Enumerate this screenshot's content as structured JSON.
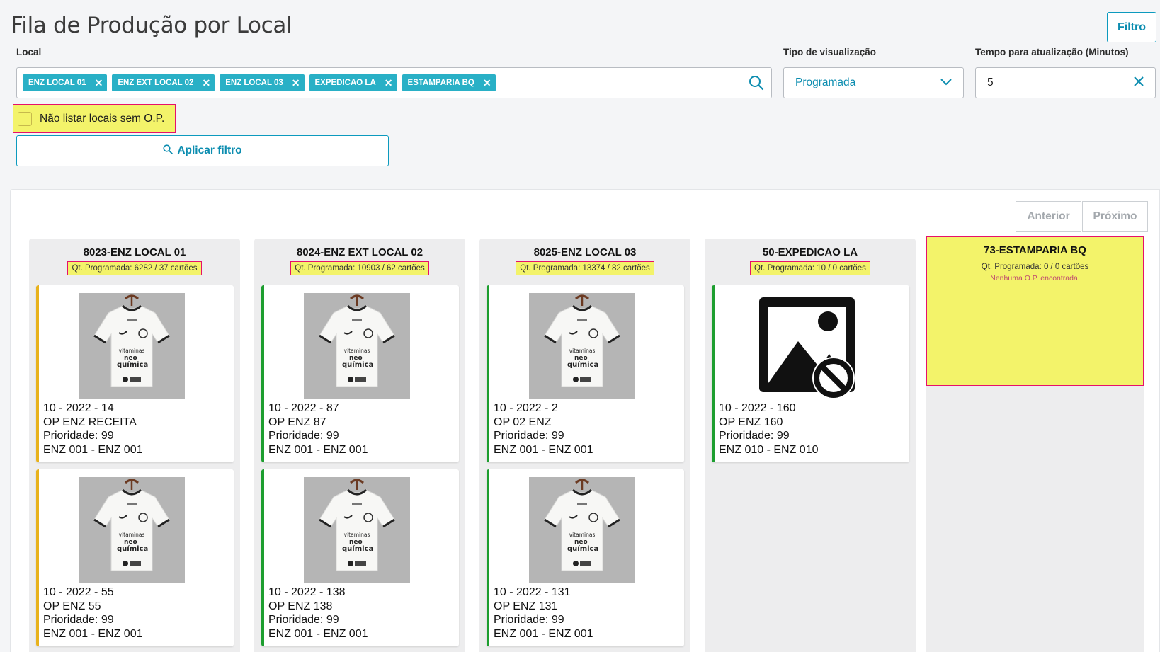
{
  "header": {
    "title": "Fila de Produção por Local",
    "filter_button": "Filtro"
  },
  "filters": {
    "local_label": "Local",
    "locals": [
      "ENZ LOCAL 01",
      "ENZ EXT LOCAL 02",
      "ENZ LOCAL 03",
      "EXPEDICAO LA",
      "ESTAMPARIA BQ"
    ],
    "view_type_label": "Tipo de visualização",
    "view_type_value": "Programada",
    "refresh_label": "Tempo para atualização (Minutos)",
    "refresh_value": "5",
    "checkbox_label": "Não listar locais sem O.P.",
    "apply_button": "Aplicar filtro"
  },
  "pager": {
    "prev": "Anterior",
    "next": "Próximo"
  },
  "columns": [
    {
      "title": "8023-ENZ LOCAL 01",
      "qt": "Qt. Programada: 6282 / 37 cartões",
      "cards": [
        {
          "line1": "10 - 2022 - 14",
          "line2": "OP ENZ RECEITA",
          "line3": "Prioridade: 99",
          "line4": "ENZ 001 - ENZ 001"
        },
        {
          "line1": "10 - 2022 - 55",
          "line2": "OP ENZ 55",
          "line3": "Prioridade: 99",
          "line4": "ENZ 001 - ENZ 001"
        }
      ]
    },
    {
      "title": "8024-ENZ EXT LOCAL 02",
      "qt": "Qt. Programada: 10903 / 62 cartões",
      "cards": [
        {
          "line1": "10 - 2022 - 87",
          "line2": "OP ENZ 87",
          "line3": "Prioridade: 99",
          "line4": "ENZ 001 - ENZ 001"
        },
        {
          "line1": "10 - 2022 - 138",
          "line2": "OP ENZ 138",
          "line3": "Prioridade: 99",
          "line4": "ENZ 001 - ENZ 001"
        }
      ]
    },
    {
      "title": "8025-ENZ LOCAL 03",
      "qt": "Qt. Programada: 13374 / 82 cartões",
      "cards": [
        {
          "line1": "10 - 2022 - 2",
          "line2": "OP 02 ENZ",
          "line3": "Prioridade: 99",
          "line4": "ENZ 001 - ENZ 001"
        },
        {
          "line1": "10 - 2022 - 131",
          "line2": "OP ENZ 131",
          "line3": "Prioridade: 99",
          "line4": "ENZ 001 - ENZ 001"
        }
      ]
    },
    {
      "title": "50-EXPEDICAO LA",
      "qt": "Qt. Programada: 10 / 0 cartões",
      "cards": [
        {
          "line1": "10 - 2022 - 160",
          "line2": "OP ENZ 160",
          "line3": "Prioridade: 99",
          "line4": "ENZ 010 - ENZ 010"
        }
      ]
    },
    {
      "title": "73-ESTAMPARIA BQ",
      "qt": "Qt. Programada: 0 / 0 cartões",
      "empty_message": "Nenhuma O.P. encontrada."
    }
  ],
  "shirt_text": {
    "sponsor1": "vitaminas",
    "sponsor2": "neo",
    "sponsor3": "química"
  },
  "colors": {
    "accent": "#0c9abe",
    "chip": "#29b0c6",
    "highlight": "#f3f36a",
    "highlight_border": "#e6106b",
    "bar_yellow": "#e8b21c",
    "bar_green": "#1d9e2f"
  },
  "icons": {
    "search": "search-icon",
    "dropdown": "chevron-down-icon",
    "clear": "close-icon",
    "no_image": "image-unavailable-icon"
  }
}
